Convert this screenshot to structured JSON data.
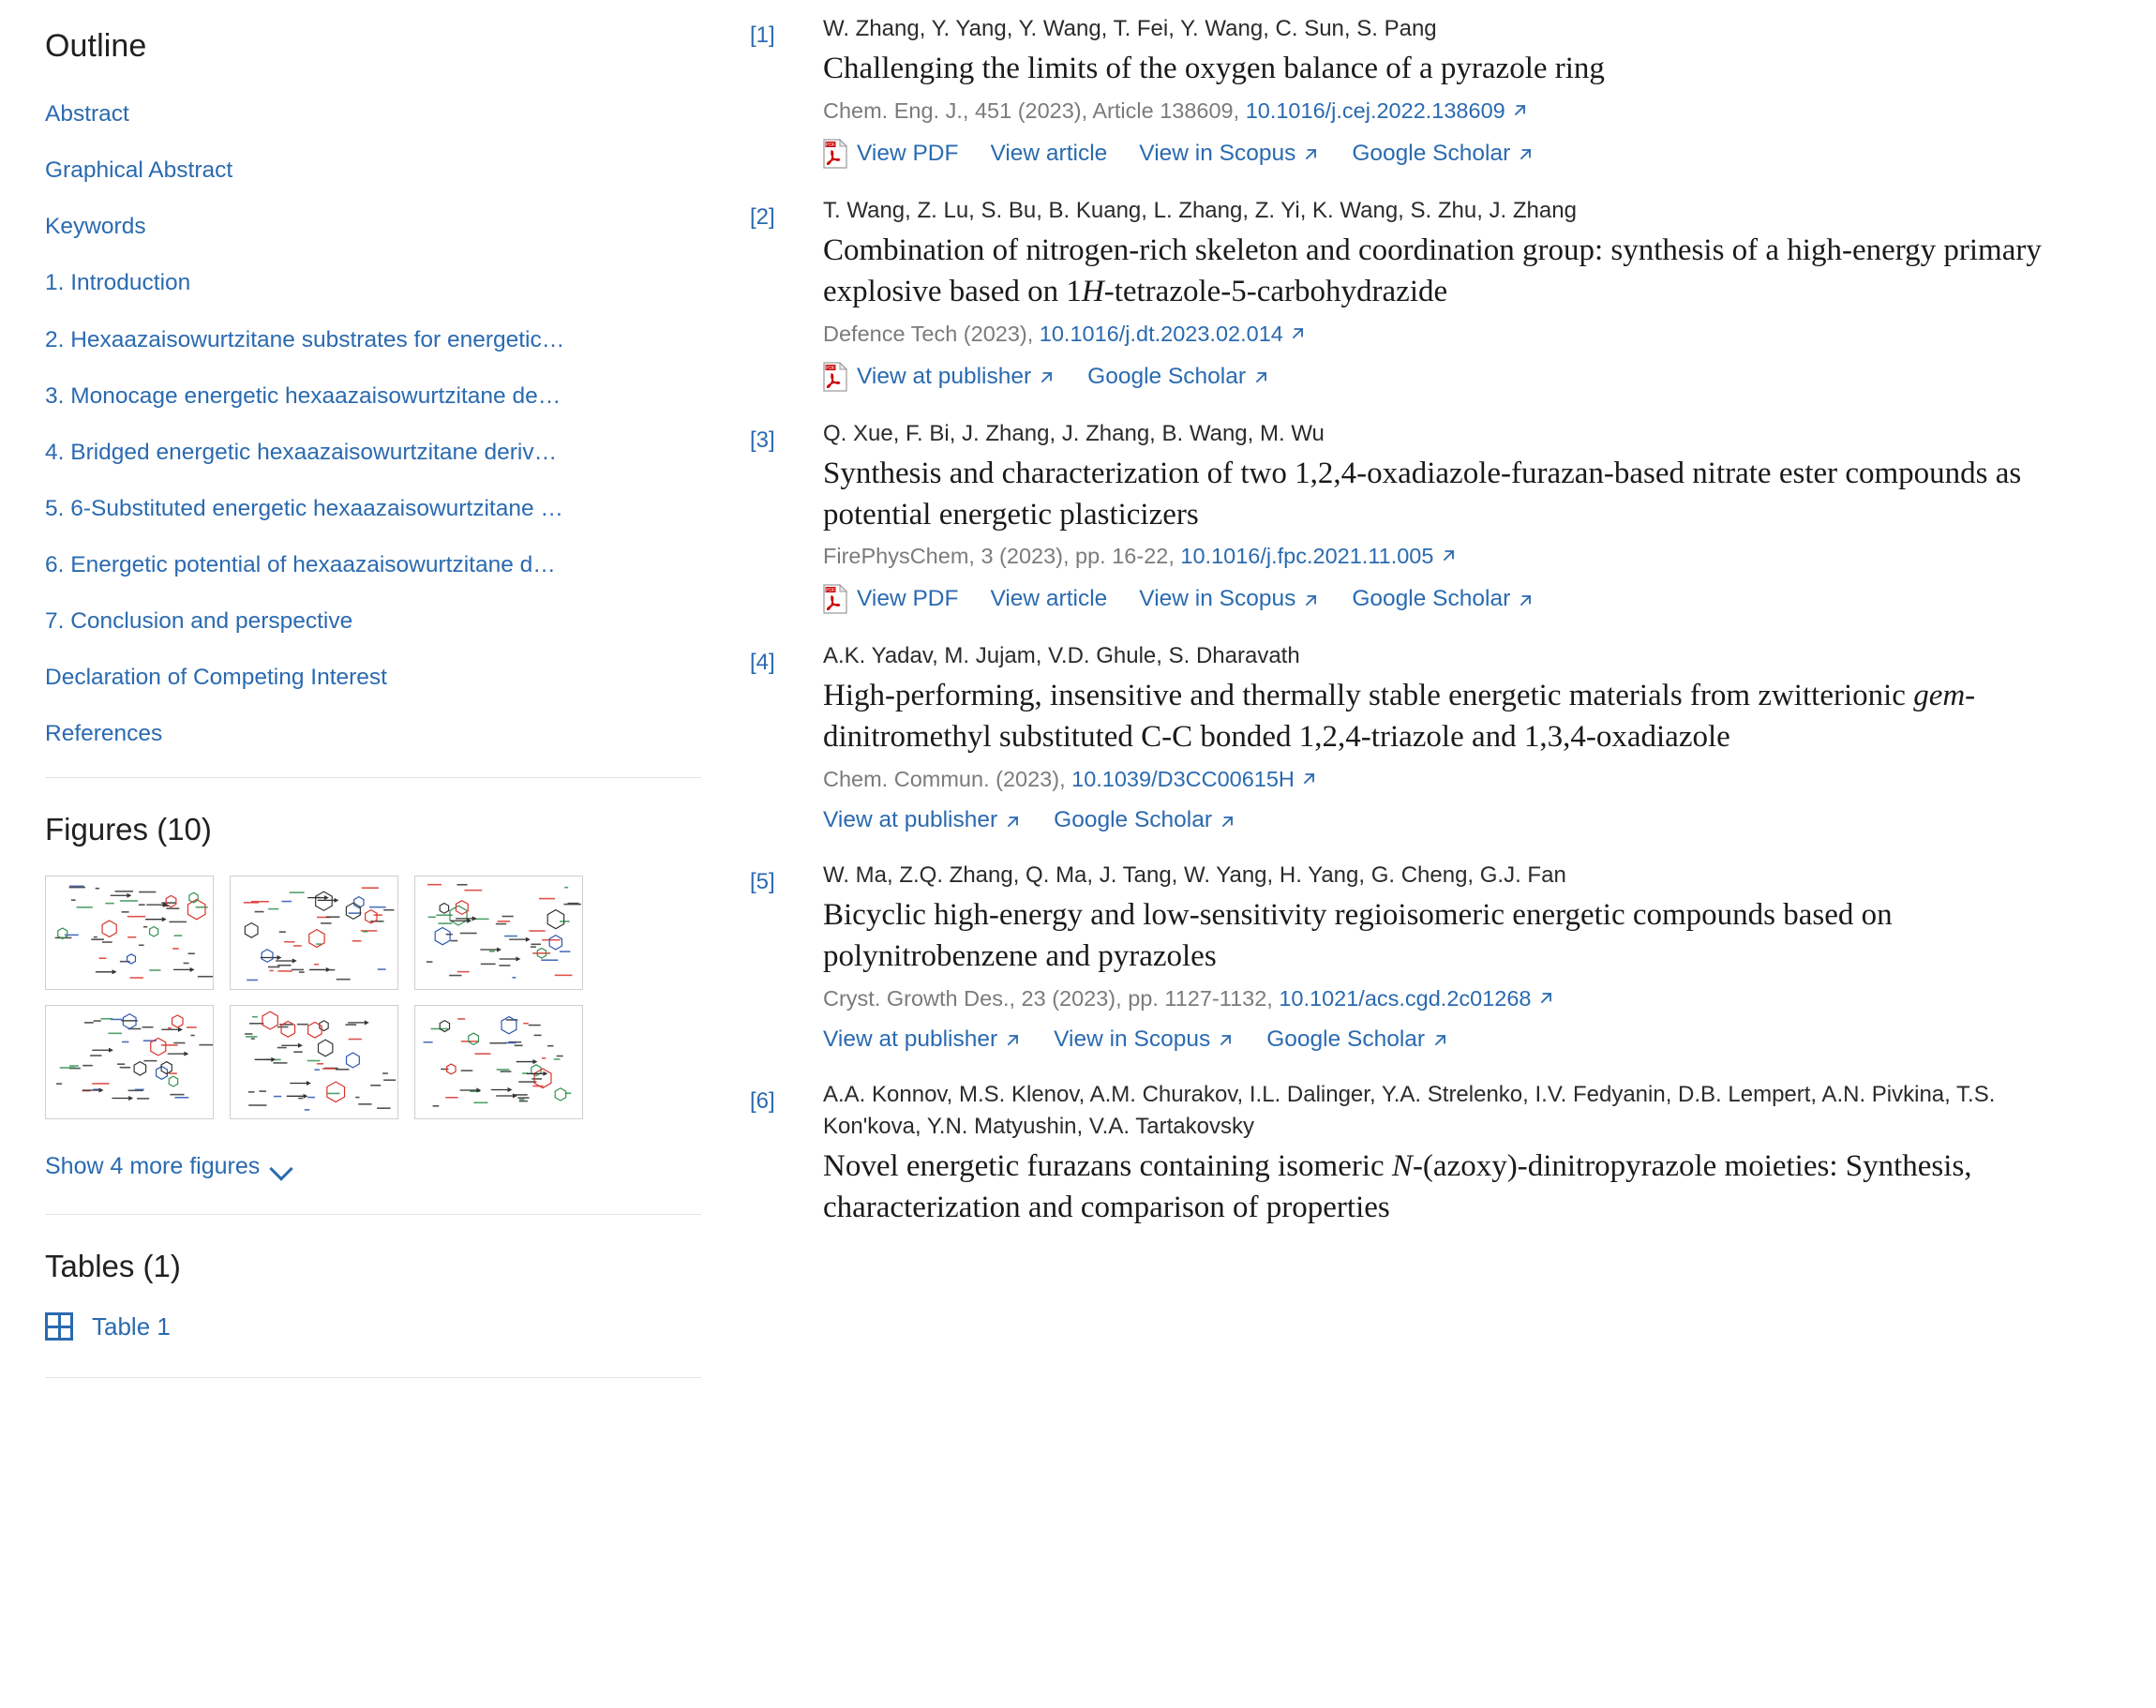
{
  "sidebar": {
    "outline_heading": "Outline",
    "outline_items": [
      "Abstract",
      "Graphical Abstract",
      "Keywords",
      "1. Introduction",
      "2. Hexaazaisowurtzitane substrates for energetic…",
      "3. Monocage energetic hexaazaisowurtzitane de…",
      "4. Bridged energetic hexaazaisowurtzitane deriv…",
      "5. 6-Substituted energetic hexaazaisowurtzitane …",
      "6. Energetic potential of hexaazaisowurtzitane d…",
      "7. Conclusion and perspective",
      "Declaration of Competing Interest",
      "References"
    ],
    "figures_heading": "Figures (10)",
    "figure_count": 6,
    "show_more_label": "Show 4 more figures",
    "chevron_icon": "chevron-down-icon",
    "tables_heading": "Tables (1)",
    "table_icon": "table-grid-icon",
    "table_label": "Table 1"
  },
  "colors": {
    "link_blue": "#2a6ab0",
    "text_dark": "#1a1a1a",
    "muted_gray": "#7b7b7b",
    "pdf_red": "#cc0000",
    "thumb_border": "#cfcfcf"
  },
  "references": [
    {
      "number": "[1]",
      "authors": "W. Zhang, Y. Yang, Y. Wang, T. Fei, Y. Wang, C. Sun, S. Pang",
      "title_html": "Challenging the limits of the oxygen balance of a pyrazole ring",
      "source_prefix": "Chem. Eng. J., 451 (2023), Article 138609, ",
      "doi": "10.1016/j.cej.2022.138609",
      "has_pdf_icon": true,
      "links": [
        {
          "label": "View PDF",
          "external": false
        },
        {
          "label": "View article",
          "external": false
        },
        {
          "label": "View in Scopus",
          "external": true
        },
        {
          "label": "Google Scholar",
          "external": true
        }
      ]
    },
    {
      "number": "[2]",
      "authors": "T. Wang, Z. Lu, S. Bu, B. Kuang, L. Zhang, Z. Yi, K. Wang, S. Zhu, J. Zhang",
      "title_html": "Combination of nitrogen-rich skeleton and coordination group: synthesis of a high-energy primary explosive based on 1<i>H</i>-tetrazole-5-carbohydrazide",
      "source_prefix": "Defence Tech (2023), ",
      "doi": "10.1016/j.dt.2023.02.014",
      "has_pdf_icon": true,
      "links": [
        {
          "label": "View at publisher",
          "external": true
        },
        {
          "label": "Google Scholar",
          "external": true
        }
      ]
    },
    {
      "number": "[3]",
      "authors": "Q. Xue, F. Bi, J. Zhang, J. Zhang, B. Wang, M. Wu",
      "title_html": "Synthesis and characterization of two 1,2,4-oxadiazole-furazan-based nitrate ester compounds as potential energetic plasticizers",
      "source_prefix": "FirePhysChem, 3 (2023), pp. 16-22, ",
      "doi": "10.1016/j.fpc.2021.11.005",
      "has_pdf_icon": true,
      "links": [
        {
          "label": "View PDF",
          "external": false
        },
        {
          "label": "View article",
          "external": false
        },
        {
          "label": "View in Scopus",
          "external": true
        },
        {
          "label": "Google Scholar",
          "external": true
        }
      ]
    },
    {
      "number": "[4]",
      "authors": "A.K. Yadav, M. Jujam, V.D. Ghule, S. Dharavath",
      "title_html": "High-performing, insensitive and thermally stable energetic materials from zwitterionic <i>gem</i>-dinitromethyl substituted C-C bonded 1,2,4-triazole and 1,3,4-oxadiazole",
      "source_prefix": "Chem. Commun. (2023), ",
      "doi": "10.1039/D3CC00615H",
      "has_pdf_icon": false,
      "links": [
        {
          "label": "View at publisher",
          "external": true
        },
        {
          "label": "Google Scholar",
          "external": true
        }
      ]
    },
    {
      "number": "[5]",
      "authors": "W. Ma, Z.Q. Zhang, Q. Ma, J. Tang, W. Yang, H. Yang, G. Cheng, G.J. Fan",
      "title_html": "Bicyclic high-energy and low-sensitivity regioisomeric energetic compounds based on polynitrobenzene and pyrazoles",
      "source_prefix": "Cryst. Growth Des., 23 (2023), pp. 1127-1132, ",
      "doi": "10.1021/acs.cgd.2c01268",
      "has_pdf_icon": false,
      "links": [
        {
          "label": "View at publisher",
          "external": true
        },
        {
          "label": "View in Scopus",
          "external": true
        },
        {
          "label": "Google Scholar",
          "external": true
        }
      ]
    },
    {
      "number": "[6]",
      "authors": "A.A. Konnov, M.S. Klenov, A.M. Churakov, I.L. Dalinger, Y.A. Strelenko, I.V. Fedyanin, D.B. Lempert, A.N. Pivkina, T.S. Kon'kova, Y.N. Matyushin, V.A. Tartakovsky",
      "title_html": "Novel energetic furazans containing isomeric <i>N</i>-(azoxy)-dinitropyrazole moieties: Synthesis, characterization and comparison of properties",
      "source_prefix": "",
      "doi": "",
      "has_pdf_icon": false,
      "links": []
    }
  ]
}
